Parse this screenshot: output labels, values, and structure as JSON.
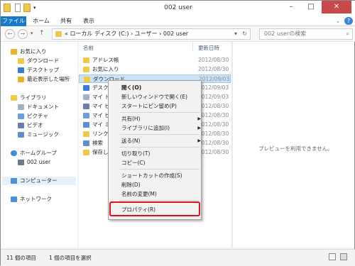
{
  "window": {
    "title": "002 user",
    "controls": [
      "–",
      "□",
      "✕"
    ]
  },
  "ribbon": {
    "tabs": [
      "ファイル",
      "ホーム",
      "共有",
      "表示"
    ],
    "help": "?"
  },
  "address": {
    "path": "« ローカル ディスク (C:) › ユーザー › 002 user",
    "search_placeholder": "002 userの検索"
  },
  "nav": {
    "items": [
      {
        "label": "お気に入り",
        "icon": "star-icon",
        "color": "#e8b52a"
      },
      {
        "label": "ダウンロード",
        "icon": "download-folder-icon",
        "color": "#f0c94a"
      },
      {
        "label": "デスクトップ",
        "icon": "desktop-icon",
        "color": "#3a7bd5"
      },
      {
        "label": "最近表示した場所",
        "icon": "recent-places-icon",
        "color": "#e8b52a"
      },
      {
        "label": "ライブラリ",
        "icon": "library-icon",
        "color": "#f0c94a"
      },
      {
        "label": "ドキュメント",
        "icon": "documents-icon",
        "color": "#9fb3c8"
      },
      {
        "label": "ピクチャ",
        "icon": "pictures-icon",
        "color": "#6aa0d8"
      },
      {
        "label": "ビデオ",
        "icon": "videos-icon",
        "color": "#6a7fb0"
      },
      {
        "label": "ミュージック",
        "icon": "music-icon",
        "color": "#5b8fd0"
      },
      {
        "label": "ホームグループ",
        "icon": "homegroup-icon",
        "color": "#3c8fd6"
      },
      {
        "label": "002 user",
        "icon": "user-icon",
        "color": "#6b7b8c"
      },
      {
        "label": "コンピューター",
        "icon": "computer-icon",
        "color": "#4a8fd8"
      },
      {
        "label": "ネットワーク",
        "icon": "network-icon",
        "color": "#4a8fd8"
      }
    ]
  },
  "files": {
    "col_name": "名前",
    "col_date": "更新日時",
    "rows": [
      {
        "name": "アドレス帳",
        "date": "2012/08/30"
      },
      {
        "name": "お気に入り",
        "date": "2012/08/30"
      },
      {
        "name": "ダウンロード",
        "date": "2012/09/03"
      },
      {
        "name": "デスクト",
        "date": "2012/09/03"
      },
      {
        "name": "マイ ドキ",
        "date": "2012/09/03"
      },
      {
        "name": "マイ ビデ",
        "date": "2012/08/30"
      },
      {
        "name": "マイ ピク",
        "date": "2012/08/30"
      },
      {
        "name": "マイ ミュ",
        "date": "2012/08/30"
      },
      {
        "name": "リンク",
        "date": "2012/08/30"
      },
      {
        "name": "検索",
        "date": "2012/08/30"
      },
      {
        "name": "保存した",
        "date": "2012/08/30"
      }
    ]
  },
  "preview": {
    "message": "プレビューを利用できません。"
  },
  "status": {
    "count": "11 個の項目",
    "selected": "1 個の項目を選択"
  },
  "context_menu": {
    "items": [
      {
        "label": "開く(O)",
        "bold": true
      },
      {
        "label": "新しいウィンドウで開く(E)"
      },
      {
        "label": "スタートにピン留め(P)"
      },
      {
        "label": "共有(H)",
        "submenu": true
      },
      {
        "label": "ライブラリに追加(I)",
        "submenu": true
      },
      {
        "label": "送る(N)",
        "submenu": true
      },
      {
        "label": "切り取り(T)"
      },
      {
        "label": "コピー(C)"
      },
      {
        "label": "ショートカットの作成(S)"
      },
      {
        "label": "削除(D)"
      },
      {
        "label": "名前の変更(M)"
      },
      {
        "label": "プロパティ(R)"
      }
    ],
    "highlight_color": "#e0101e"
  }
}
